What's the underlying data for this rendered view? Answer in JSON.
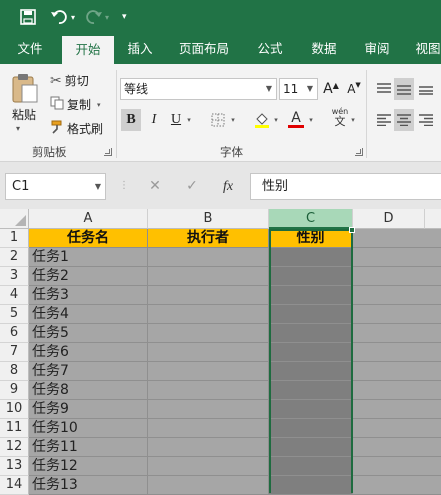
{
  "colors": {
    "accent": "#217346",
    "header_fill": "#ffc000",
    "cell_fill": "#a6a6a6",
    "selected_fill": "#7f7f7f"
  },
  "tabs": [
    {
      "label": "文件",
      "active": false
    },
    {
      "label": "开始",
      "active": true
    },
    {
      "label": "插入",
      "active": false
    },
    {
      "label": "页面布局",
      "active": false
    },
    {
      "label": "公式",
      "active": false
    },
    {
      "label": "数据",
      "active": false
    },
    {
      "label": "审阅",
      "active": false
    },
    {
      "label": "视图",
      "active": false
    }
  ],
  "clipboard": {
    "paste_label": "粘贴",
    "cut_label": "剪切",
    "copy_label": "复制",
    "format_painter_label": "格式刷",
    "group_label": "剪贴板"
  },
  "font": {
    "font_name": "等线",
    "font_size": "11",
    "bold_label": "B",
    "italic_label": "I",
    "underline_label": "U",
    "font_color_label": "A",
    "phonetic_top": "wén",
    "phonetic_bottom": "文",
    "grow_label": "A",
    "shrink_label": "A",
    "group_label": "字体"
  },
  "formula_bar": {
    "name_box": "C1",
    "fx_label": "fx",
    "content": "性别"
  },
  "sheet": {
    "columns": [
      "A",
      "B",
      "C",
      "D"
    ],
    "selected_column": "C",
    "row_numbers": [
      "1",
      "2",
      "3",
      "4",
      "5",
      "6",
      "7",
      "8",
      "9",
      "10",
      "11",
      "12",
      "13",
      "14"
    ],
    "header_row": [
      "任务名",
      "执行者",
      "性别"
    ],
    "tasks": [
      "任务1",
      "任务2",
      "任务3",
      "任务4",
      "任务5",
      "任务6",
      "任务7",
      "任务8",
      "任务9",
      "任务10",
      "任务11",
      "任务12",
      "任务13"
    ]
  }
}
